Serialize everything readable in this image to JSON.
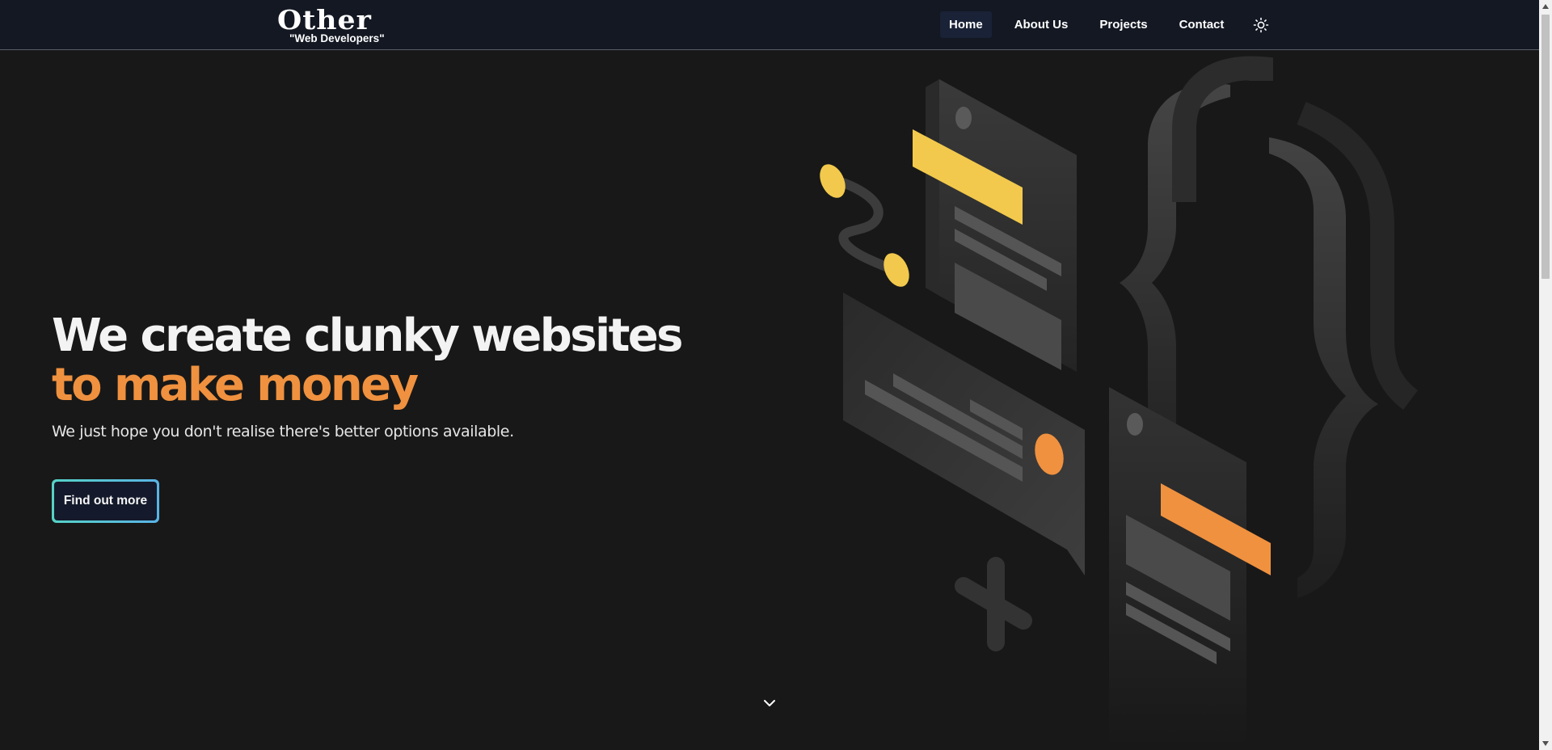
{
  "header": {
    "logo_title": "Other",
    "logo_subtitle": "\"Web Developers\"",
    "nav": [
      {
        "label": "Home",
        "active": true
      },
      {
        "label": "About Us",
        "active": false
      },
      {
        "label": "Projects",
        "active": false
      },
      {
        "label": "Contact",
        "active": false
      }
    ],
    "theme_icon": "sun-icon"
  },
  "hero": {
    "title_line1": "We create clunky websites",
    "title_line2": "to make money",
    "subtitle": "We just hope you don't realise there's better options available.",
    "cta_label": "Find out more",
    "scroll_icon": "chevron-down-icon"
  },
  "colors": {
    "background": "#181818",
    "navbar": "#131823",
    "accent_orange": "#f0913f",
    "accent_yellow": "#f2c94c",
    "cta_border_start": "#56d2c6",
    "cta_border_end": "#59b3e6"
  }
}
